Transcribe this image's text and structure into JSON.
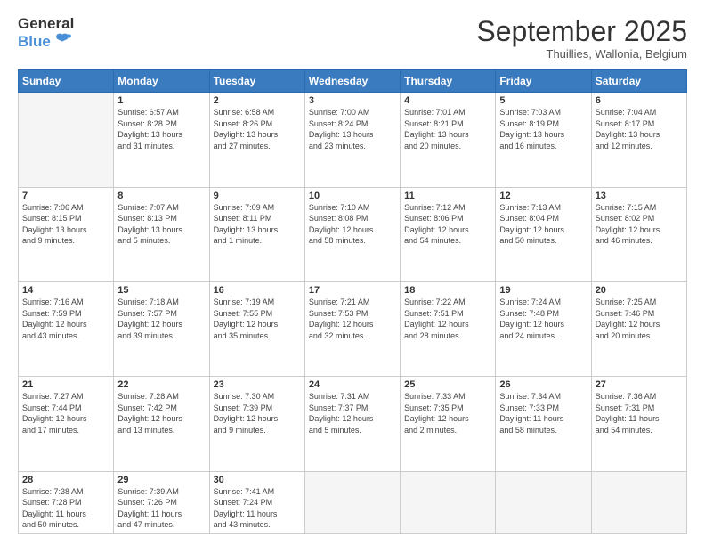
{
  "logo": {
    "general": "General",
    "blue": "Blue"
  },
  "title": "September 2025",
  "subtitle": "Thuillies, Wallonia, Belgium",
  "days_header": [
    "Sunday",
    "Monday",
    "Tuesday",
    "Wednesday",
    "Thursday",
    "Friday",
    "Saturday"
  ],
  "weeks": [
    [
      {
        "num": "",
        "info": ""
      },
      {
        "num": "1",
        "info": "Sunrise: 6:57 AM\nSunset: 8:28 PM\nDaylight: 13 hours\nand 31 minutes."
      },
      {
        "num": "2",
        "info": "Sunrise: 6:58 AM\nSunset: 8:26 PM\nDaylight: 13 hours\nand 27 minutes."
      },
      {
        "num": "3",
        "info": "Sunrise: 7:00 AM\nSunset: 8:24 PM\nDaylight: 13 hours\nand 23 minutes."
      },
      {
        "num": "4",
        "info": "Sunrise: 7:01 AM\nSunset: 8:21 PM\nDaylight: 13 hours\nand 20 minutes."
      },
      {
        "num": "5",
        "info": "Sunrise: 7:03 AM\nSunset: 8:19 PM\nDaylight: 13 hours\nand 16 minutes."
      },
      {
        "num": "6",
        "info": "Sunrise: 7:04 AM\nSunset: 8:17 PM\nDaylight: 13 hours\nand 12 minutes."
      }
    ],
    [
      {
        "num": "7",
        "info": "Sunrise: 7:06 AM\nSunset: 8:15 PM\nDaylight: 13 hours\nand 9 minutes."
      },
      {
        "num": "8",
        "info": "Sunrise: 7:07 AM\nSunset: 8:13 PM\nDaylight: 13 hours\nand 5 minutes."
      },
      {
        "num": "9",
        "info": "Sunrise: 7:09 AM\nSunset: 8:11 PM\nDaylight: 13 hours\nand 1 minute."
      },
      {
        "num": "10",
        "info": "Sunrise: 7:10 AM\nSunset: 8:08 PM\nDaylight: 12 hours\nand 58 minutes."
      },
      {
        "num": "11",
        "info": "Sunrise: 7:12 AM\nSunset: 8:06 PM\nDaylight: 12 hours\nand 54 minutes."
      },
      {
        "num": "12",
        "info": "Sunrise: 7:13 AM\nSunset: 8:04 PM\nDaylight: 12 hours\nand 50 minutes."
      },
      {
        "num": "13",
        "info": "Sunrise: 7:15 AM\nSunset: 8:02 PM\nDaylight: 12 hours\nand 46 minutes."
      }
    ],
    [
      {
        "num": "14",
        "info": "Sunrise: 7:16 AM\nSunset: 7:59 PM\nDaylight: 12 hours\nand 43 minutes."
      },
      {
        "num": "15",
        "info": "Sunrise: 7:18 AM\nSunset: 7:57 PM\nDaylight: 12 hours\nand 39 minutes."
      },
      {
        "num": "16",
        "info": "Sunrise: 7:19 AM\nSunset: 7:55 PM\nDaylight: 12 hours\nand 35 minutes."
      },
      {
        "num": "17",
        "info": "Sunrise: 7:21 AM\nSunset: 7:53 PM\nDaylight: 12 hours\nand 32 minutes."
      },
      {
        "num": "18",
        "info": "Sunrise: 7:22 AM\nSunset: 7:51 PM\nDaylight: 12 hours\nand 28 minutes."
      },
      {
        "num": "19",
        "info": "Sunrise: 7:24 AM\nSunset: 7:48 PM\nDaylight: 12 hours\nand 24 minutes."
      },
      {
        "num": "20",
        "info": "Sunrise: 7:25 AM\nSunset: 7:46 PM\nDaylight: 12 hours\nand 20 minutes."
      }
    ],
    [
      {
        "num": "21",
        "info": "Sunrise: 7:27 AM\nSunset: 7:44 PM\nDaylight: 12 hours\nand 17 minutes."
      },
      {
        "num": "22",
        "info": "Sunrise: 7:28 AM\nSunset: 7:42 PM\nDaylight: 12 hours\nand 13 minutes."
      },
      {
        "num": "23",
        "info": "Sunrise: 7:30 AM\nSunset: 7:39 PM\nDaylight: 12 hours\nand 9 minutes."
      },
      {
        "num": "24",
        "info": "Sunrise: 7:31 AM\nSunset: 7:37 PM\nDaylight: 12 hours\nand 5 minutes."
      },
      {
        "num": "25",
        "info": "Sunrise: 7:33 AM\nSunset: 7:35 PM\nDaylight: 12 hours\nand 2 minutes."
      },
      {
        "num": "26",
        "info": "Sunrise: 7:34 AM\nSunset: 7:33 PM\nDaylight: 11 hours\nand 58 minutes."
      },
      {
        "num": "27",
        "info": "Sunrise: 7:36 AM\nSunset: 7:31 PM\nDaylight: 11 hours\nand 54 minutes."
      }
    ],
    [
      {
        "num": "28",
        "info": "Sunrise: 7:38 AM\nSunset: 7:28 PM\nDaylight: 11 hours\nand 50 minutes."
      },
      {
        "num": "29",
        "info": "Sunrise: 7:39 AM\nSunset: 7:26 PM\nDaylight: 11 hours\nand 47 minutes."
      },
      {
        "num": "30",
        "info": "Sunrise: 7:41 AM\nSunset: 7:24 PM\nDaylight: 11 hours\nand 43 minutes."
      },
      {
        "num": "",
        "info": ""
      },
      {
        "num": "",
        "info": ""
      },
      {
        "num": "",
        "info": ""
      },
      {
        "num": "",
        "info": ""
      }
    ]
  ]
}
